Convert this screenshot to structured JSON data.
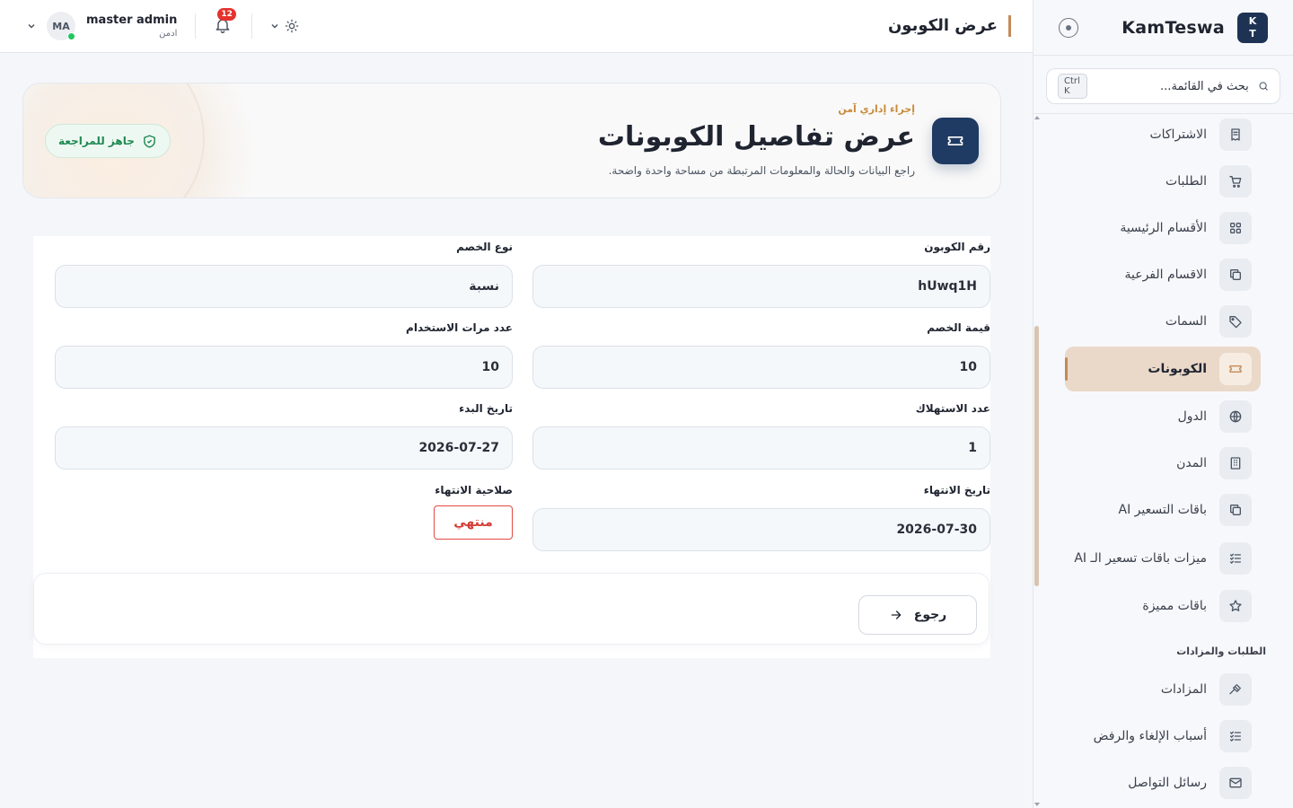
{
  "app": {
    "brand": "KamTeswa",
    "logo_top": "K",
    "logo_bottom": "T"
  },
  "sidebar": {
    "search": {
      "placeholder": "بحث في القائمة...",
      "shortcut": "Ctrl K"
    },
    "items": [
      {
        "label": "الاشتراكات",
        "icon": "receipt-icon"
      },
      {
        "label": "الطلبات",
        "icon": "cart-icon"
      },
      {
        "label": "الأقسام الرئيسية",
        "icon": "grid-icon"
      },
      {
        "label": "الاقسام الفرعية",
        "icon": "copy-icon"
      },
      {
        "label": "السمات",
        "icon": "tag-icon"
      },
      {
        "label": "الكوبونات",
        "icon": "ticket-icon",
        "active": true
      },
      {
        "label": "الدول",
        "icon": "globe-icon"
      },
      {
        "label": "المدن",
        "icon": "building-icon"
      },
      {
        "label": "باقات التسعير AI",
        "icon": "copy-icon"
      },
      {
        "label": "ميزات باقات تسعير الـ AI",
        "icon": "list-check-icon"
      },
      {
        "label": "باقات مميزة",
        "icon": "star-icon"
      }
    ],
    "section_orders": "الطلبات والمزادات",
    "items2": [
      {
        "label": "المزادات",
        "icon": "gavel-icon"
      },
      {
        "label": "أسباب الإلغاء والرفض",
        "icon": "list-check-icon"
      },
      {
        "label": "رسائل التواصل",
        "icon": "mail-icon"
      }
    ]
  },
  "topbar": {
    "title": "عرض الكوبون",
    "user": {
      "name": "master admin",
      "role": "ادمن",
      "initials": "MA"
    },
    "notifications": "12"
  },
  "hero": {
    "eyebrow": "إجراء إداري آمن",
    "title": "عرض تفاصيل الكوبونات",
    "subtitle": "راجع البيانات والحالة والمعلومات المرتبطة من مساحة واحدة واضحة.",
    "badge": "جاهز للمراجعة"
  },
  "form": {
    "coupon_code": {
      "label": "رقم الكوبون",
      "value": "hUwq1H"
    },
    "discount_type": {
      "label": "نوع الخصم",
      "value": "نسبة"
    },
    "discount_value": {
      "label": "قيمة الخصم",
      "value": "10"
    },
    "usage_count": {
      "label": "عدد مرات الاستخدام",
      "value": "10"
    },
    "redemptions": {
      "label": "عدد الاستهلاك",
      "value": "1"
    },
    "start_date": {
      "label": "تاريخ البدء",
      "value": "2026-07-27"
    },
    "end_date": {
      "label": "تاريخ الانتهاء",
      "value": "2026-07-30"
    },
    "expiry_status": {
      "label": "صلاحية الانتهاء",
      "value": "منتهي"
    },
    "back_label": "رجوع"
  },
  "colors": {
    "accent": "#c48a57",
    "navy": "#1f3a63",
    "success": "#1f8a52",
    "danger": "#d33a34"
  }
}
